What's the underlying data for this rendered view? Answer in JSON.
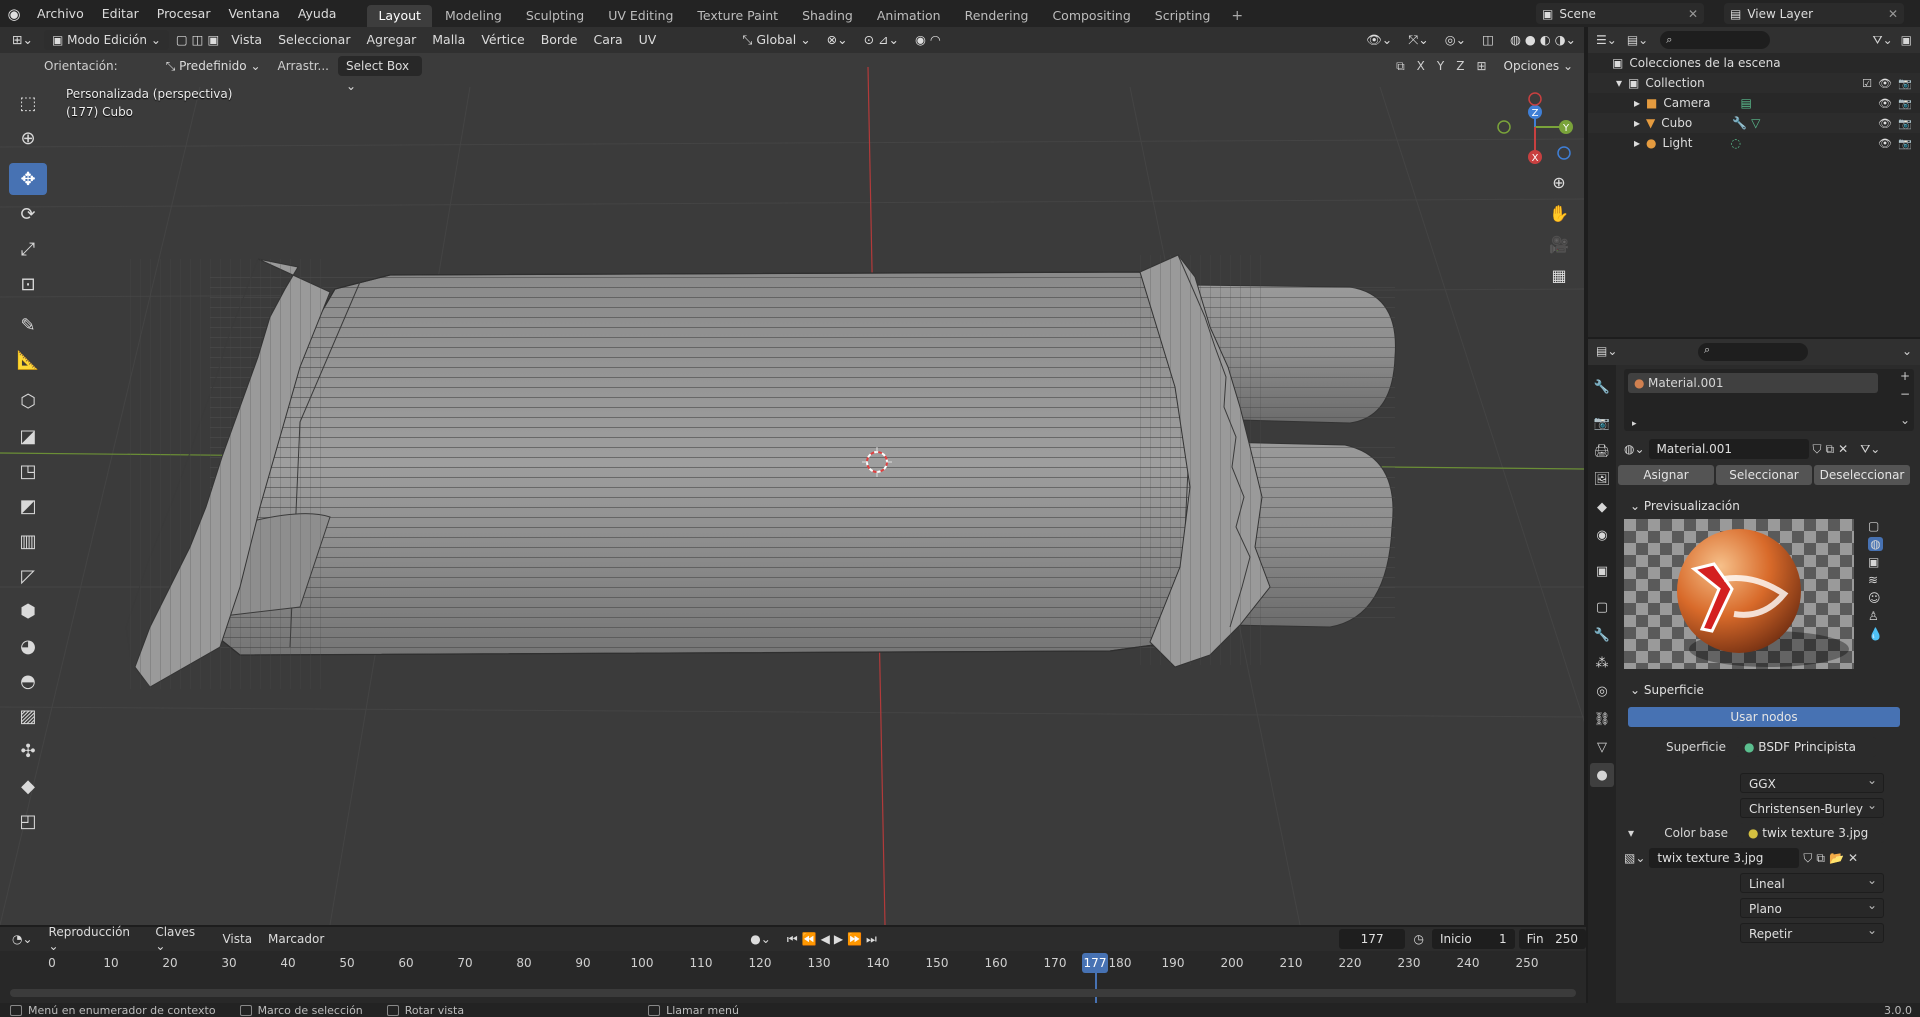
{
  "app": {
    "menu": [
      "Archivo",
      "Editar",
      "Procesar",
      "Ventana",
      "Ayuda"
    ],
    "workspaces": [
      "Layout",
      "Modeling",
      "Sculpting",
      "UV Editing",
      "Texture Paint",
      "Shading",
      "Animation",
      "Rendering",
      "Compositing",
      "Scripting"
    ],
    "active_workspace": "Layout",
    "scene": "Scene",
    "view_layer": "View Layer",
    "version": "3.0.0"
  },
  "viewport": {
    "mode": "Modo Edición",
    "menus": [
      "Vista",
      "Seleccionar",
      "Agregar",
      "Malla",
      "Vértice",
      "Borde",
      "Cara",
      "UV"
    ],
    "transform_orientation": "Global",
    "orientation_label": "Orientación:",
    "orientation_value": "Predefinido",
    "drag_label": "Arrastr...",
    "drag_value": "Select Box",
    "options_label": "Opciones",
    "axes_toggles": [
      "X",
      "Y",
      "Z"
    ],
    "view_name": "Personalizada (perspectiva)",
    "object_label": "(177) Cubo",
    "gizmo_axes": [
      "Z",
      "Y",
      "X"
    ]
  },
  "outliner": {
    "root": "Colecciones de la escena",
    "collection": "Collection",
    "items": [
      {
        "name": "Camera",
        "icon": "camera-icon"
      },
      {
        "name": "Cubo",
        "icon": "mesh-icon"
      },
      {
        "name": "Light",
        "icon": "light-icon"
      }
    ]
  },
  "properties": {
    "material_slot": "Material.001",
    "material_name": "Material.001",
    "buttons": [
      "Asignar",
      "Seleccionar",
      "Deseleccionar"
    ],
    "preview_title": "Previsualización",
    "surface_title": "Superficie",
    "use_nodes": "Usar nodos",
    "surface_label": "Superficie",
    "surface_value": "BSDF Principista",
    "distribution": "GGX",
    "subsurface_method": "Christensen-Burley",
    "color_base_label": "Color base",
    "color_base_value": "twix texture 3.jpg",
    "image_name": "twix texture 3.jpg",
    "interpolation": "Lineal",
    "projection": "Plano",
    "extension": "Repetir"
  },
  "timeline": {
    "menus": [
      "Reproducción",
      "Claves",
      "Vista",
      "Marcador"
    ],
    "current_frame": "177",
    "start_label": "Inicio",
    "start_value": "1",
    "end_label": "Fin",
    "end_value": "250",
    "ticks": [
      "0",
      "10",
      "20",
      "30",
      "40",
      "50",
      "60",
      "70",
      "80",
      "90",
      "100",
      "110",
      "120",
      "130",
      "140",
      "150",
      "160",
      "170",
      "180",
      "190",
      "200",
      "210",
      "220",
      "230",
      "240",
      "250"
    ]
  },
  "statusbar": {
    "items": [
      "Menú en enumerador de contexto",
      "Marco de selección",
      "Rotar vista",
      "Llamar menú"
    ]
  },
  "colors": {
    "accent": "#4772b3",
    "viewport_bg": "#3b3b3b",
    "x_axis": "#c84040",
    "y_axis": "#7aa33a",
    "z_axis": "#3f7fd6"
  }
}
